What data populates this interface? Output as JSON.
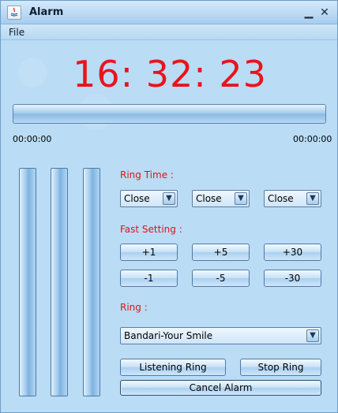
{
  "window": {
    "title": "Alarm",
    "minimize_label": "▁",
    "close_label": "✕"
  },
  "menu": {
    "file": "File"
  },
  "clock": {
    "time": "16: 32: 23",
    "color": "#e8141c"
  },
  "playback": {
    "elapsed": "00:00:00",
    "total": "00:00:00"
  },
  "ring_time": {
    "label": "Ring Time :",
    "combos": [
      "Close",
      "Close",
      "Close"
    ]
  },
  "fast_setting": {
    "label": "Fast Setting :",
    "buttons": [
      "+1",
      "+5",
      "+30",
      "-1",
      "-5",
      "-30"
    ]
  },
  "ring": {
    "label": "Ring :",
    "selected": "Bandari-Your Smile"
  },
  "actions": {
    "listening": "Listening Ring",
    "stop": "Stop Ring",
    "cancel": "Cancel Alarm"
  },
  "colors": {
    "accent_red": "#e01318",
    "background": "#badcf5"
  }
}
